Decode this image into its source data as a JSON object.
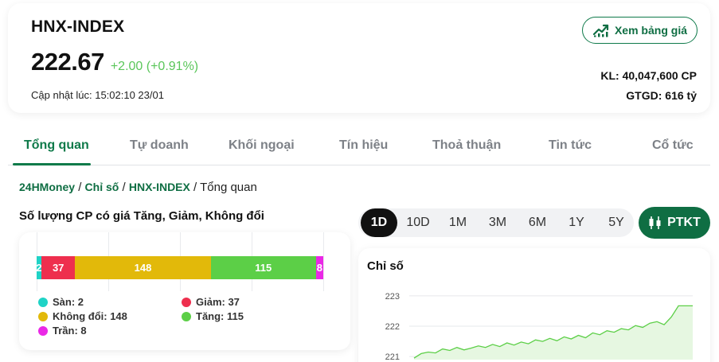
{
  "header": {
    "index_name": "HNX-INDEX",
    "price": "222.67",
    "change": "+2.00 (+0.91%)",
    "updated": "Cập nhật lúc: 15:02:10 23/01",
    "board_button": "Xem bảng giá",
    "volume": "KL: 40,047,600 CP",
    "value": "GTGD: 616 tỷ"
  },
  "tabs": [
    {
      "label": "Tổng quan",
      "active": true
    },
    {
      "label": "Tự doanh"
    },
    {
      "label": "Khối ngoại"
    },
    {
      "label": "Tín hiệu"
    },
    {
      "label": "Thoả thuận"
    },
    {
      "label": "Tin tức"
    },
    {
      "label": "Cổ tức"
    }
  ],
  "breadcrumb": {
    "home": "24HMoney",
    "section": "Chỉ số",
    "index": "HNX-INDEX",
    "current": "Tổng quan",
    "sep": "/"
  },
  "distribution": {
    "title": "Số lượng CP có giá Tăng, Giảm, Không đổi",
    "segments": [
      {
        "key": "san",
        "value": 2,
        "label": "2",
        "color": "#1fd3c6"
      },
      {
        "key": "giam",
        "value": 37,
        "label": "37",
        "color": "#ee2f4e"
      },
      {
        "key": "khongdoi",
        "value": 148,
        "label": "148",
        "color": "#e2b90a"
      },
      {
        "key": "tang",
        "value": 115,
        "label": "115",
        "color": "#5ccf47"
      },
      {
        "key": "tran",
        "value": 8,
        "label": "8",
        "color": "#ea28e6"
      }
    ],
    "legend": [
      {
        "text": "Sàn: 2",
        "color": "#1fd3c6"
      },
      {
        "text": "Giảm: 37",
        "color": "#ee2f4e"
      },
      {
        "text": "Không đổi: 148",
        "color": "#e2b90a"
      },
      {
        "text": "Tăng: 115",
        "color": "#5ccf47"
      },
      {
        "text": "Trần: 8",
        "color": "#ea28e6"
      }
    ]
  },
  "ranges": [
    {
      "label": "1D",
      "active": true
    },
    {
      "label": "10D"
    },
    {
      "label": "1M"
    },
    {
      "label": "3M"
    },
    {
      "label": "6M"
    },
    {
      "label": "1Y"
    },
    {
      "label": "5Y"
    }
  ],
  "ptkt_button": "PTKT",
  "chart": {
    "title": "Chỉ số",
    "y_ticks": [
      "223",
      "222",
      "221"
    ],
    "ylim": [
      220.9,
      223.1
    ],
    "line_color": "#5ccf47",
    "fill_color": "#e6f7e1",
    "values": [
      220.95,
      221.1,
      221.15,
      221.12,
      221.25,
      221.2,
      221.3,
      221.22,
      221.28,
      221.35,
      221.3,
      221.4,
      221.33,
      221.45,
      221.38,
      221.48,
      221.42,
      221.55,
      221.5,
      221.6,
      221.52,
      221.65,
      221.58,
      221.7,
      221.62,
      221.78,
      221.72,
      221.85,
      221.8,
      221.92,
      221.88,
      222.02,
      221.96,
      222.1,
      222.15,
      222.05,
      222.3,
      222.67,
      222.67,
      222.67
    ]
  }
}
